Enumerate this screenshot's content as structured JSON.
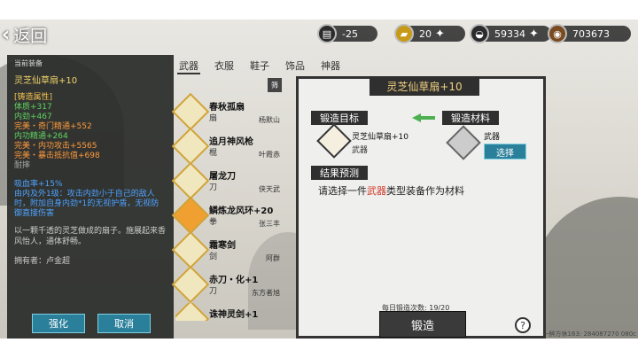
{
  "header": {
    "back_label": "返回",
    "resources": [
      {
        "icon": "stamina-icon",
        "glyph": "▤",
        "value": "-25"
      },
      {
        "icon": "gold-bar-icon",
        "glyph": "▰",
        "value": "20"
      },
      {
        "icon": "silver-ingot-icon",
        "glyph": "◒",
        "value": "59334"
      },
      {
        "icon": "coin-icon",
        "glyph": "◉",
        "value": "703673"
      }
    ]
  },
  "left_panel": {
    "header": "当前装备",
    "item_name": "灵芝仙草扇+10",
    "attr_title": "[铸造属性]",
    "attrs": [
      "体质+317",
      "内劲+467"
    ],
    "perfects": [
      "完美・奇门精通+552",
      "内功精通+264",
      "完美・内功攻击+5565",
      "完美・暴击抵抗值+698"
    ],
    "special": "耐摔",
    "drain": [
      "吸血率+15%",
      "由内及外1级：攻击内劲小于自己的敌人时，附加自身内劲*1的无视护盾，无视防御直接伤害"
    ],
    "description": "以一颗千透的灵芝做成的扇子。施展起来香风怡人，通体舒畅。",
    "owner": "拥有者：卢金超",
    "enhance_label": "强化",
    "cancel_label": "取消"
  },
  "tabs": [
    "武器",
    "衣服",
    "鞋子",
    "饰品",
    "神器"
  ],
  "active_tab": 0,
  "filter_label": "筛",
  "item_list": [
    {
      "name": "春秋孤扇",
      "type": "扇",
      "owner": "杨默山"
    },
    {
      "name": "追月神风枪",
      "type": "棍",
      "owner": "叶霞赤"
    },
    {
      "name": "屠龙刀",
      "type": "刀",
      "owner": "侠天武"
    },
    {
      "name": "鳞炼龙风环+20",
      "type": "拳",
      "owner": "张三丰"
    },
    {
      "name": "霜寒剑",
      "type": "剑",
      "owner": "阿群"
    },
    {
      "name": "赤刀・化+1",
      "type": "刀",
      "owner": "东方者旭"
    },
    {
      "name": "诛神灵剑+1",
      "type": "剑",
      "owner": ""
    }
  ],
  "forge_panel": {
    "title": "灵芝仙草扇+10",
    "target_label": "锻造目标",
    "material_label": "锻造材料",
    "target_name": "灵芝仙草扇+10",
    "target_type": "武器",
    "material_type": "武器",
    "select_label": "选择",
    "result_label": "结果预测",
    "result_prefix": "请选择一件",
    "result_highlight": "武器",
    "result_suffix": "类型装备作为材料",
    "daily_count": "每日锻造次数: 19/20",
    "forge_label": "锻造",
    "help_label": "?"
  },
  "footer_text": "一醉方休163: 284087270  080c",
  "colors": {
    "accent_teal": "#2a7f9a",
    "highlight_red": "#d33a2a",
    "title_gold": "#f0d080"
  }
}
